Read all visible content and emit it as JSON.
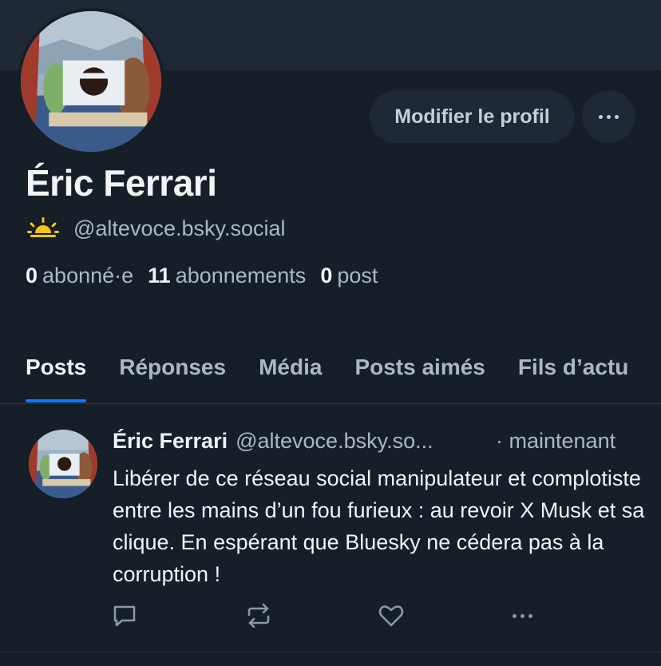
{
  "profile": {
    "display_name": "Éric Ferrari",
    "handle": "@altevoce.bsky.social",
    "edit_button": "Modifier le profil",
    "stats": {
      "followers_count": "0",
      "followers_label": "abonné·e",
      "following_count": "11",
      "following_label": "abonnements",
      "posts_count": "0",
      "posts_label": "post"
    }
  },
  "tabs": [
    {
      "label": "Posts",
      "active": true
    },
    {
      "label": "Réponses",
      "active": false
    },
    {
      "label": "Média",
      "active": false
    },
    {
      "label": "Posts aimés",
      "active": false
    },
    {
      "label": "Fils d’actu",
      "active": false
    }
  ],
  "post": {
    "author_name": "Éric Ferrari",
    "author_handle": "@altevoce.bsky.so...",
    "time": "· maintenant",
    "text": "Libérer de ce réseau social manipulateur et complotiste entre les mains d’un fou furieux : au revoir X Musk et sa clique. En espérant que Bluesky ne cédera pas à la corruption !"
  },
  "icons": {
    "handle_badge": "sunrise-icon",
    "more": "ellipsis-icon",
    "reply": "comment-icon",
    "repost": "repost-icon",
    "like": "heart-icon",
    "post_more": "ellipsis-icon"
  },
  "colors": {
    "background": "#161e27",
    "banner": "#1e2935",
    "accent": "#0a7aff",
    "sun": "#f5c518"
  }
}
